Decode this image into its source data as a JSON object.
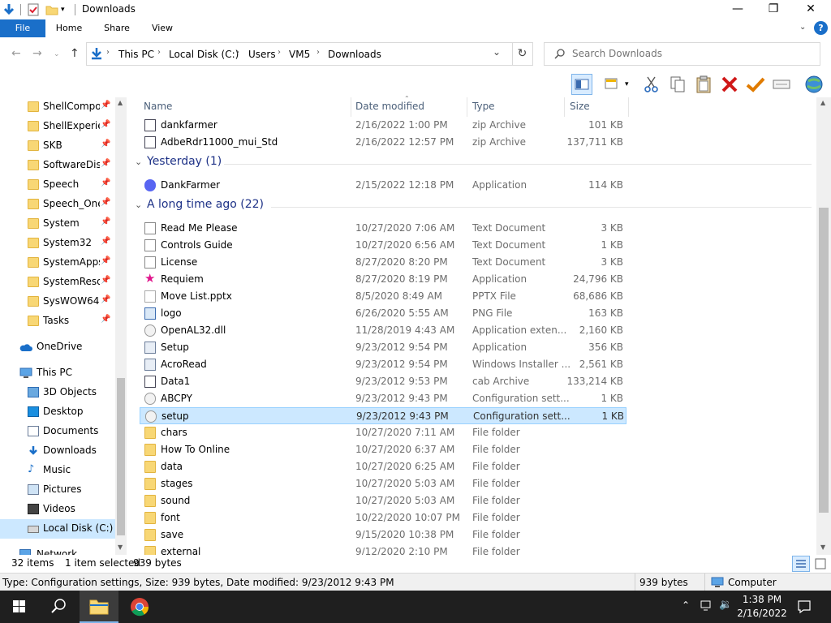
{
  "window": {
    "title": "Downloads",
    "controls": {
      "minimize": "—",
      "maximize": "❐",
      "close": "✕"
    }
  },
  "ribbon": {
    "tabs": [
      "File",
      "Home",
      "Share",
      "View"
    ]
  },
  "address": {
    "crumbs": [
      "This PC",
      "Local Disk (C:)",
      "Users",
      "VM5",
      "Downloads"
    ]
  },
  "search": {
    "placeholder": "Search Downloads"
  },
  "nav": {
    "quick_access": [
      "ShellCompor",
      "ShellExperien",
      "SKB",
      "SoftwareDistr",
      "Speech",
      "Speech_OneC",
      "System",
      "System32",
      "SystemApps",
      "SystemResou",
      "SysWOW64",
      "Tasks"
    ],
    "onedrive": "OneDrive",
    "this_pc": "This PC",
    "this_pc_items": [
      "3D Objects",
      "Desktop",
      "Documents",
      "Downloads",
      "Music",
      "Pictures",
      "Videos",
      "Local Disk (C:)"
    ],
    "network": "Network"
  },
  "columns": {
    "name": "Name",
    "date": "Date modified",
    "type": "Type",
    "size": "Size"
  },
  "groups": {
    "yesterday": "Yesterday (1)",
    "long_ago": "A long time ago (22)"
  },
  "files_today": [
    {
      "name": "dankfarmer",
      "date": "2/16/2022 1:00 PM",
      "type": "zip Archive",
      "size": "101 KB",
      "icon": "zip-icon"
    },
    {
      "name": "AdbeRdr11000_mui_Std",
      "date": "2/16/2022 12:57 PM",
      "type": "zip Archive",
      "size": "137,711 KB",
      "icon": "zip-icon"
    }
  ],
  "files_yesterday": [
    {
      "name": "DankFarmer",
      "date": "2/15/2022 12:18 PM",
      "type": "Application",
      "size": "114 KB",
      "icon": "discord-icon"
    }
  ],
  "files_old": [
    {
      "name": "Read Me Please",
      "date": "10/27/2020 7:06 AM",
      "type": "Text Document",
      "size": "3 KB",
      "icon": "text-document-icon"
    },
    {
      "name": "Controls Guide",
      "date": "10/27/2020 6:56 AM",
      "type": "Text Document",
      "size": "1 KB",
      "icon": "text-document-icon"
    },
    {
      "name": "License",
      "date": "8/27/2020 8:20 PM",
      "type": "Text Document",
      "size": "3 KB",
      "icon": "text-document-icon"
    },
    {
      "name": "Requiem",
      "date": "8/27/2020 8:19 PM",
      "type": "Application",
      "size": "24,796 KB",
      "icon": "star-app-icon"
    },
    {
      "name": "Move List.pptx",
      "date": "8/5/2020 8:49 AM",
      "type": "PPTX File",
      "size": "68,686 KB",
      "icon": "blank-file-icon"
    },
    {
      "name": "logo",
      "date": "6/26/2020 5:55 AM",
      "type": "PNG File",
      "size": "163 KB",
      "icon": "image-icon"
    },
    {
      "name": "OpenAL32.dll",
      "date": "11/28/2019 4:43 AM",
      "type": "Application exten...",
      "size": "2,160 KB",
      "icon": "dll-icon"
    },
    {
      "name": "Setup",
      "date": "9/23/2012 9:54 PM",
      "type": "Application",
      "size": "356 KB",
      "icon": "installer-icon"
    },
    {
      "name": "AcroRead",
      "date": "9/23/2012 9:54 PM",
      "type": "Windows Installer ...",
      "size": "2,561 KB",
      "icon": "installer-icon"
    },
    {
      "name": "Data1",
      "date": "9/23/2012 9:53 PM",
      "type": "cab Archive",
      "size": "133,214 KB",
      "icon": "cab-icon"
    },
    {
      "name": "ABCPY",
      "date": "9/23/2012 9:43 PM",
      "type": "Configuration sett...",
      "size": "1 KB",
      "icon": "config-icon"
    },
    {
      "name": "setup",
      "date": "9/23/2012 9:43 PM",
      "type": "Configuration sett...",
      "size": "1 KB",
      "icon": "config-icon",
      "selected": true
    },
    {
      "name": "chars",
      "date": "10/27/2020 7:11 AM",
      "type": "File folder",
      "size": "",
      "icon": "folder-icon"
    },
    {
      "name": "How To Online",
      "date": "10/27/2020 6:37 AM",
      "type": "File folder",
      "size": "",
      "icon": "folder-icon"
    },
    {
      "name": "data",
      "date": "10/27/2020 6:25 AM",
      "type": "File folder",
      "size": "",
      "icon": "folder-icon"
    },
    {
      "name": "stages",
      "date": "10/27/2020 5:03 AM",
      "type": "File folder",
      "size": "",
      "icon": "folder-icon"
    },
    {
      "name": "sound",
      "date": "10/27/2020 5:03 AM",
      "type": "File folder",
      "size": "",
      "icon": "folder-icon"
    },
    {
      "name": "font",
      "date": "10/22/2020 10:07 PM",
      "type": "File folder",
      "size": "",
      "icon": "folder-icon"
    },
    {
      "name": "save",
      "date": "9/15/2020 10:38 PM",
      "type": "File folder",
      "size": "",
      "icon": "folder-icon"
    },
    {
      "name": "external",
      "date": "9/12/2020 2:10 PM",
      "type": "File folder",
      "size": "",
      "icon": "folder-icon"
    }
  ],
  "status": {
    "items": "32 items",
    "selected": "1 item selected",
    "bytes": "939 bytes"
  },
  "details": {
    "text": "Type: Configuration settings, Size: 939 bytes, Date modified: 9/23/2012 9:43 PM",
    "size": "939 bytes",
    "location": "Computer"
  },
  "clock": {
    "time": "1:38 PM",
    "date": "2/16/2022"
  },
  "colors": {
    "accent": "#1a6fc9",
    "selection": "#cce8ff",
    "group_text": "#1e3287",
    "taskbar": "#1f1f1f"
  }
}
